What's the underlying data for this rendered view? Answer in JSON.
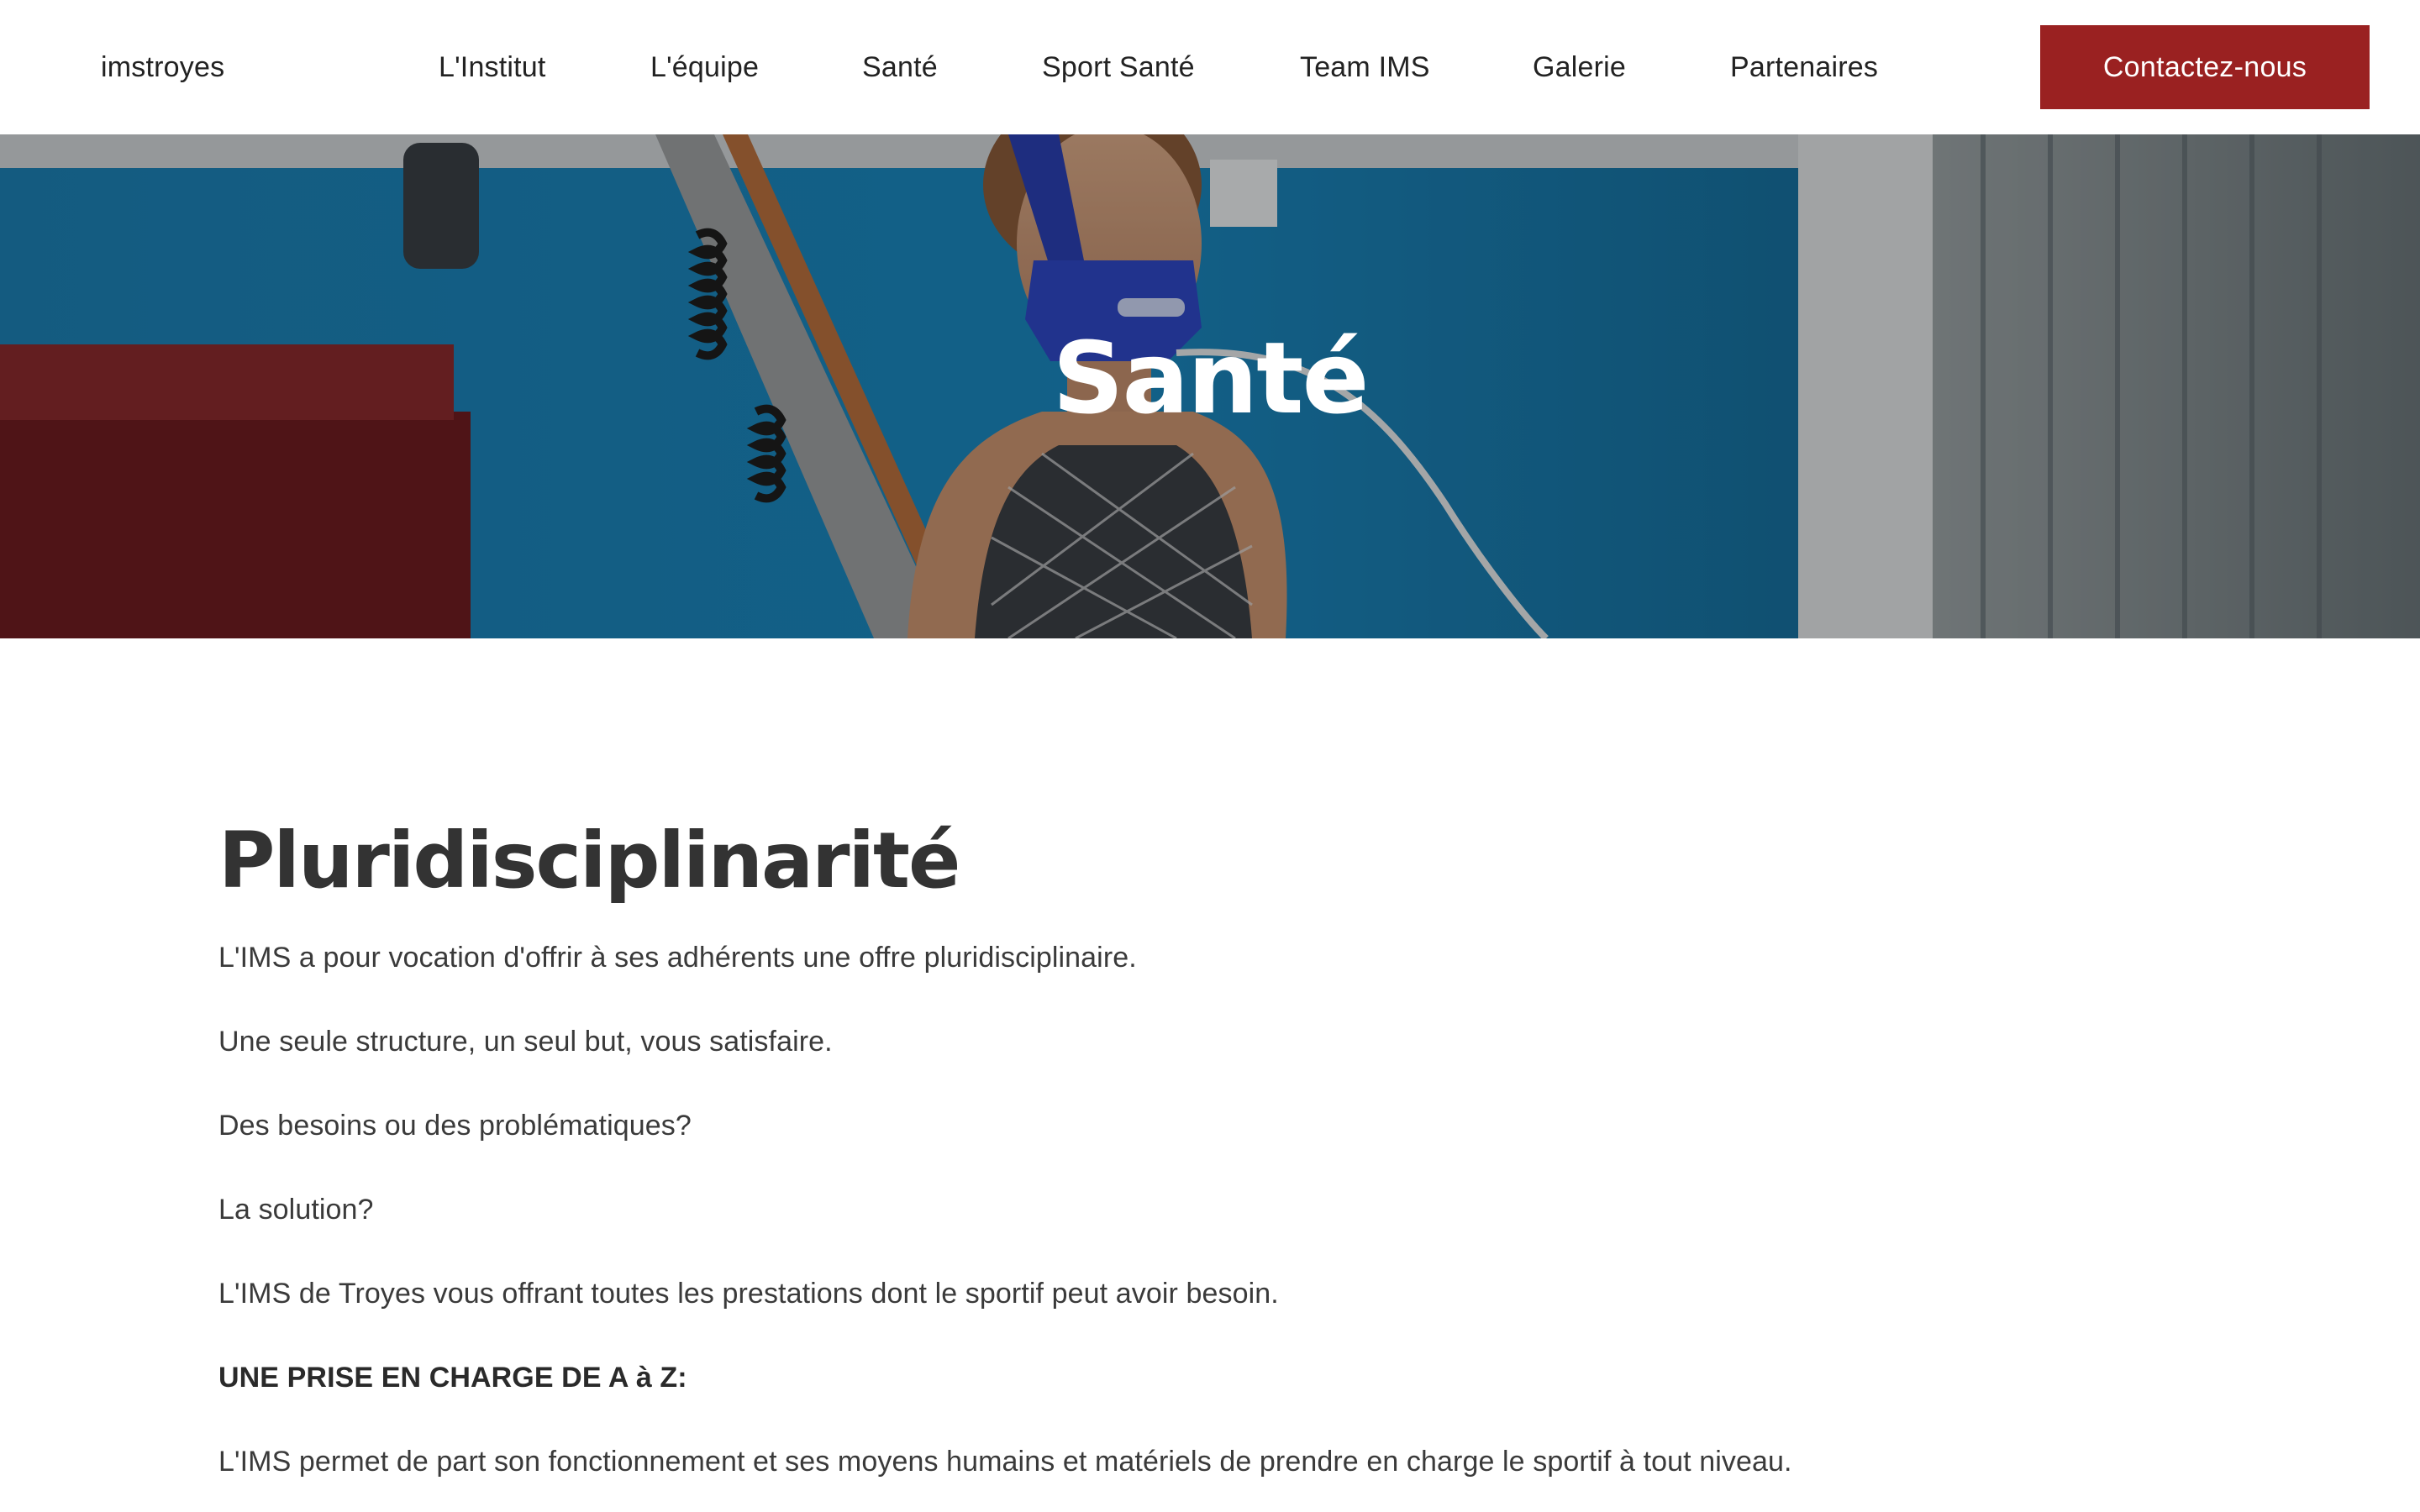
{
  "header": {
    "brand": "imstroyes",
    "nav": [
      {
        "label": "L'Institut"
      },
      {
        "label": "L'équipe"
      },
      {
        "label": "Santé"
      },
      {
        "label": "Sport Santé"
      },
      {
        "label": "Team IMS"
      },
      {
        "label": "Galerie"
      },
      {
        "label": "Partenaires"
      }
    ],
    "cta_label": "Contactez-nous"
  },
  "hero": {
    "title": "Santé"
  },
  "content": {
    "title": "Pluridisciplinarité",
    "paragraphs": [
      "L'IMS a pour vocation d'offrir à ses adhérents une offre pluridisciplinaire.",
      "Une seule structure, un seul but, vous satisfaire.",
      "Des besoins ou des problématiques?",
      "La solution?",
      "L'IMS de Troyes vous offrant toutes les prestations dont le sportif peut avoir besoin.",
      "UNE PRISE EN CHARGE DE A à Z:",
      "L'IMS permet de part son fonctionnement et ses moyens humains et matériels de prendre en charge le sportif à tout niveau."
    ]
  },
  "colors": {
    "accent": "#9a2121",
    "text": "#333333",
    "hero_blue": "#1f86b8"
  }
}
